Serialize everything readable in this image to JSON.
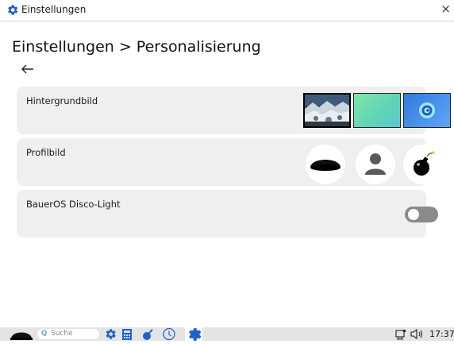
{
  "window": {
    "title": "Einstellungen",
    "close_glyph": "×"
  },
  "header": {
    "breadcrumb": "Einstellungen > Personalisierung",
    "back_glyph": "←"
  },
  "sections": [
    {
      "label": "Hintergrundbild",
      "options": [
        "landscape-wallpaper",
        "green-gradient-wallpaper",
        "blue-swirl-wallpaper"
      ]
    },
    {
      "label": "Profilbild",
      "options": [
        "hat-avatar",
        "person-avatar",
        "bomb-avatar"
      ]
    },
    {
      "label": "BauerOS Disco-Light",
      "toggle_on": false
    }
  ],
  "taskbar": {
    "search_placeholder": "Suche",
    "clock": "17:37",
    "icons": [
      "start-hat-icon",
      "settings-icon",
      "calculator-icon",
      "bomb-icon",
      "clock-icon",
      "settings-active-icon",
      "network-icon",
      "volume-icon"
    ]
  },
  "colors": {
    "accent": "#1e63c9",
    "card": "#efefef",
    "taskbar": "#e4e4e4",
    "toggle_off": "#8a8a8a"
  }
}
